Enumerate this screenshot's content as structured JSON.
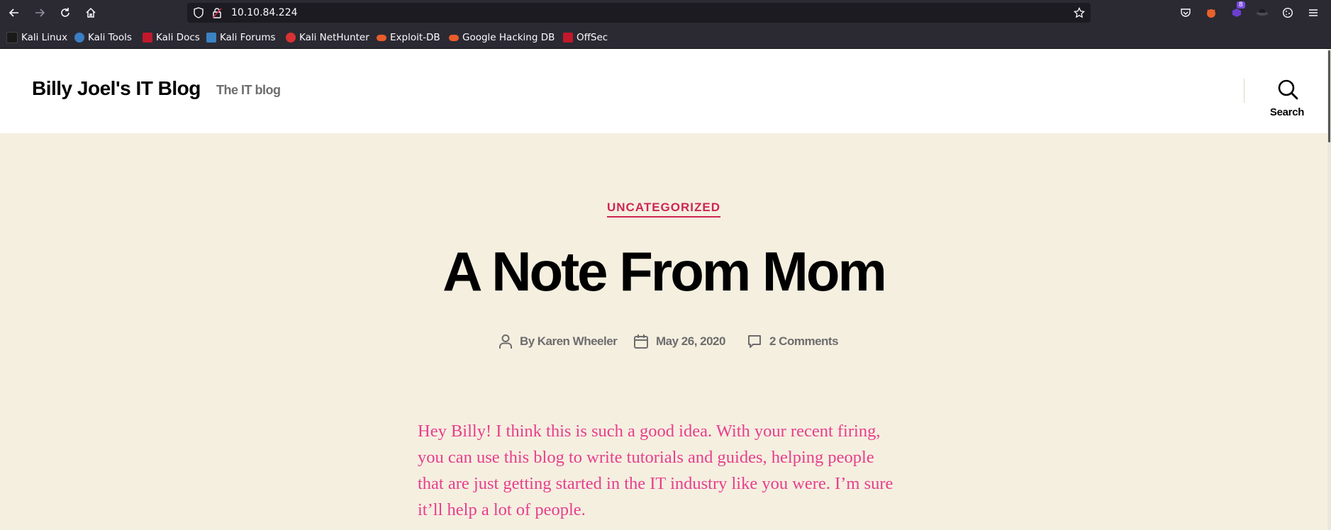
{
  "browser": {
    "url": "10.10.84.224",
    "extension_badge": "8",
    "bookmarks": [
      {
        "label": "Kali Linux",
        "color": "#1a1a1a"
      },
      {
        "label": "Kali Tools",
        "color": "#3c7ec3"
      },
      {
        "label": "Kali Docs",
        "color": "#c0192b"
      },
      {
        "label": "Kali Forums",
        "color": "#3b82c4"
      },
      {
        "label": "Kali NetHunter",
        "color": "#d93232"
      },
      {
        "label": "Exploit-DB",
        "color": "#e85d2a"
      },
      {
        "label": "Google Hacking DB",
        "color": "#e85d2a"
      },
      {
        "label": "OffSec",
        "color": "#c0192b"
      }
    ]
  },
  "site": {
    "title": "Billy Joel's IT Blog",
    "description": "The IT blog",
    "search_label": "Search"
  },
  "post": {
    "category": "UNCATEGORIZED",
    "title": "A Note From Mom",
    "author_prefix": "By",
    "author": "Karen Wheeler",
    "date": "May 26, 2020",
    "comments": "2 Comments",
    "body_lines": [
      "Hey Billy!  I think this is such a good idea.  With your recent firing,",
      "you can use this blog to write tutorials and guides, helping people",
      "that are just getting started in the IT industry like you were.  I’m sure",
      "it’ll help a lot of people."
    ]
  },
  "colors": {
    "accent": "#cd2653",
    "body_text": "#e83e8c",
    "background": "#f5efe0",
    "browser_chrome": "#2b2a33"
  }
}
